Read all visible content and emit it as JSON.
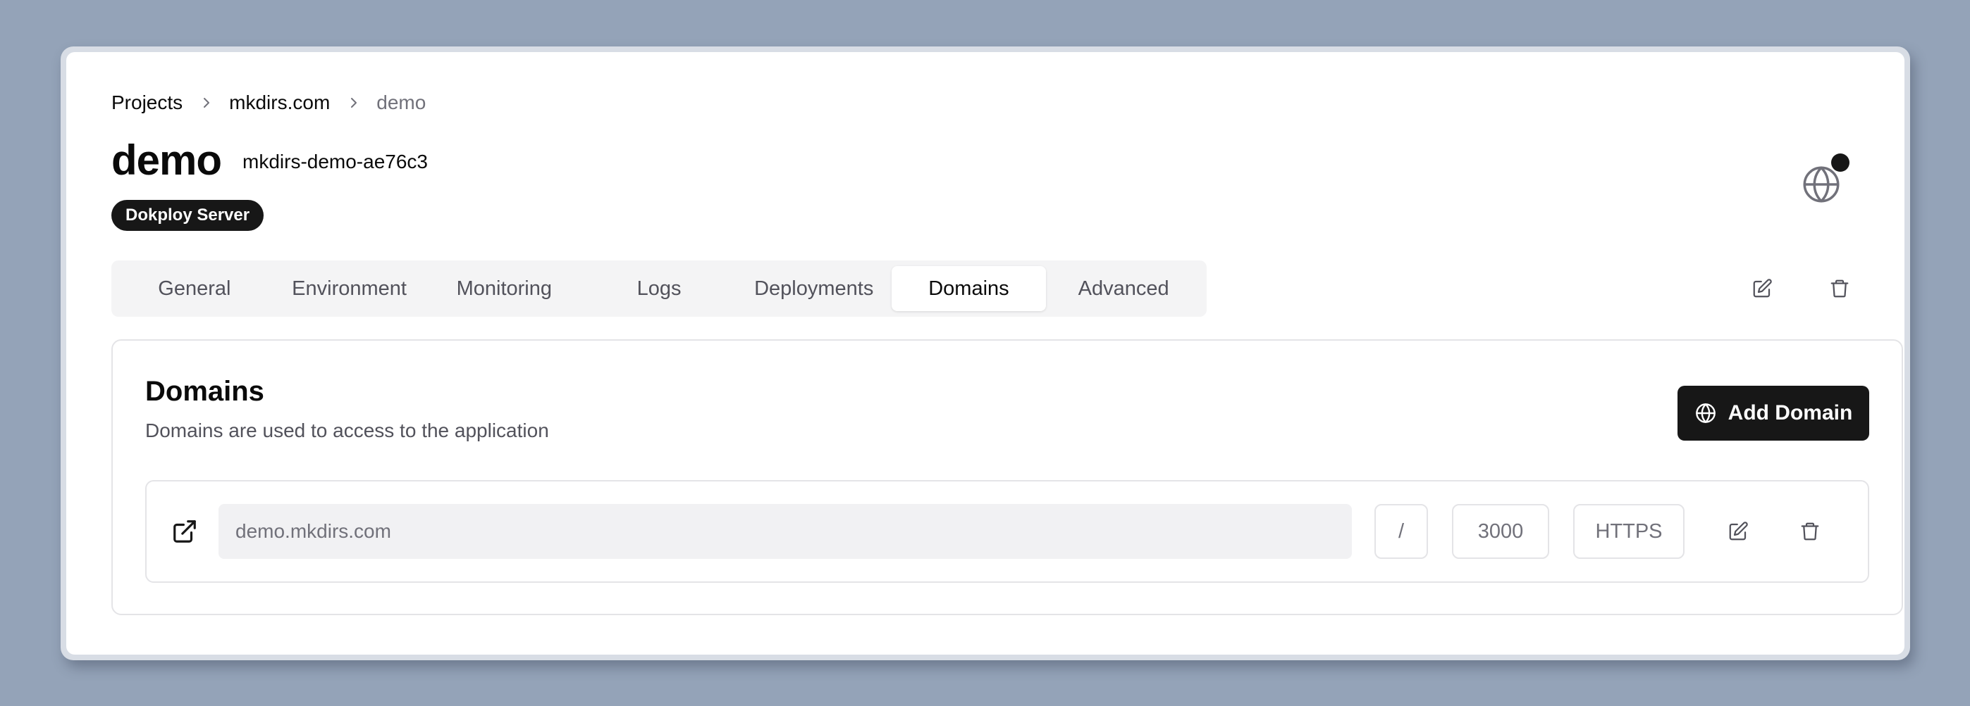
{
  "breadcrumb": {
    "items": [
      "Projects",
      "mkdirs.com",
      "demo"
    ]
  },
  "header": {
    "title": "demo",
    "app_name": "mkdirs-demo-ae76c3",
    "server_badge": "Dokploy Server"
  },
  "tabs": [
    {
      "label": "General"
    },
    {
      "label": "Environment"
    },
    {
      "label": "Monitoring"
    },
    {
      "label": "Logs"
    },
    {
      "label": "Deployments"
    },
    {
      "label": "Domains",
      "active": true
    },
    {
      "label": "Advanced"
    }
  ],
  "domains_panel": {
    "title": "Domains",
    "description": "Domains are used to access to the application",
    "add_button_label": "Add Domain",
    "rows": [
      {
        "host": "demo.mkdirs.com",
        "path": "/",
        "port": "3000",
        "protocol": "HTTPS"
      }
    ]
  },
  "icons": {
    "globe": "globe-icon",
    "edit": "edit-icon",
    "delete": "trash-icon",
    "external": "external-link-icon",
    "chevron": "chevron-right-icon"
  },
  "colors": {
    "background": "#94a3b8",
    "primary_button": "#171717",
    "muted_text": "#71717a",
    "border": "#e4e4e7"
  }
}
